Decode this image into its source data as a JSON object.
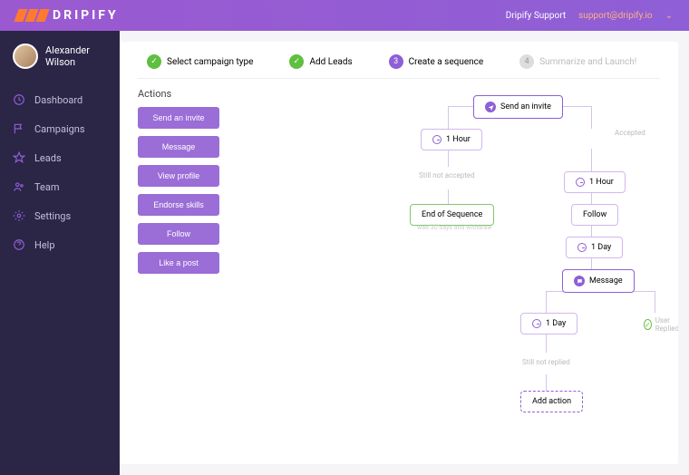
{
  "brand": "DRIPIFY",
  "header": {
    "support": "Dripify Support",
    "email": "support@dripify.io"
  },
  "user": {
    "first_name": "Alexander",
    "last_name": "Wilson"
  },
  "sidebar": {
    "items": [
      {
        "label": "Dashboard"
      },
      {
        "label": "Campaigns"
      },
      {
        "label": "Leads"
      },
      {
        "label": "Team"
      },
      {
        "label": "Settings"
      },
      {
        "label": "Help"
      }
    ]
  },
  "steps": [
    {
      "label": "Select campaign type",
      "state": "done"
    },
    {
      "label": "Add Leads",
      "state": "done"
    },
    {
      "num": "3",
      "label": "Create a sequence",
      "state": "active"
    },
    {
      "num": "4",
      "label": "Summarize and Launch!",
      "state": "disabled"
    }
  ],
  "actions": {
    "title": "Actions",
    "items": [
      "Send an invite",
      "Message",
      "View profile",
      "Endorse skills",
      "Follow",
      "Like a post"
    ]
  },
  "flow": {
    "root": "Send an invite",
    "left_wait": "1  Hour",
    "left_label": "Still not accepted",
    "left_end": "End of Sequence",
    "left_note": "wait 30 days and withdraw",
    "right_label_accepted": "Accepted",
    "right_wait1": "1  Hour",
    "right_follow": "Follow",
    "right_wait2": "1  Day",
    "right_msg": "Message",
    "right_wait3": "1  Day",
    "right_replied": "User Replied",
    "right_notreplied": "Still not replied",
    "add_action": "Add action"
  }
}
